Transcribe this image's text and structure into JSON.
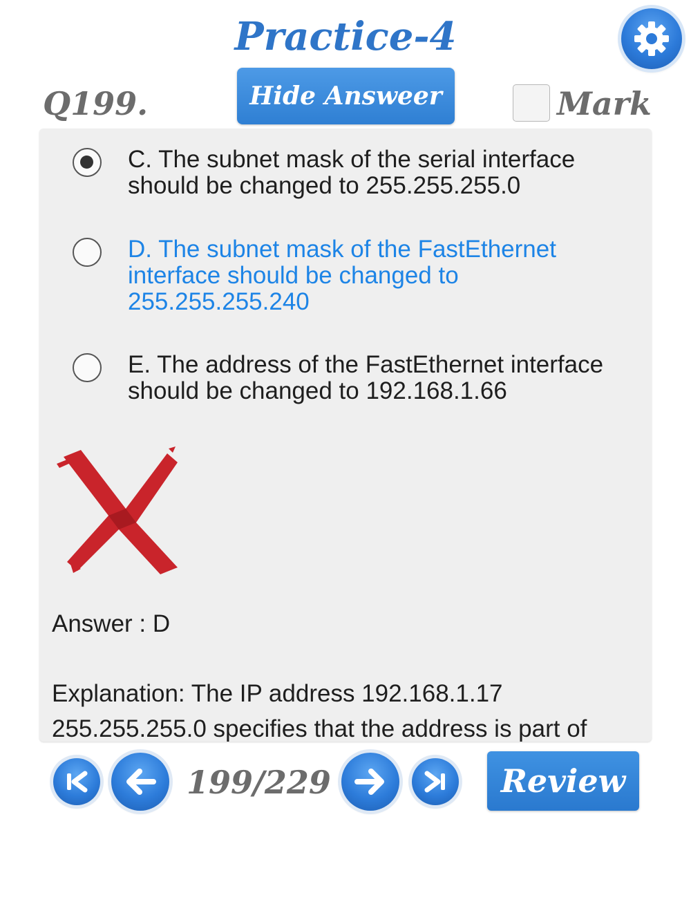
{
  "header": {
    "title": "Practice-4",
    "question_number": "Q199.",
    "hide_answer_label": "Hide Answeer",
    "mark_label": "Mark",
    "mark_checked": false
  },
  "options": [
    {
      "text": "C. The subnet mask of the serial interface should be changed to 255.255.255.0",
      "selected": true,
      "correct": false
    },
    {
      "text": "D. The subnet mask of the FastEthernet interface should be changed to 255.255.255.240",
      "selected": false,
      "correct": true
    },
    {
      "text": "E. The address of the FastEthernet interface should be changed to 192.168.1.66",
      "selected": false,
      "correct": false
    }
  ],
  "result": {
    "status": "incorrect",
    "icon": "red-x-icon"
  },
  "answer_text": "Answer : D",
  "explanation_text": "Explanation: The IP address 192.168.1.17 255.255.255.0 specifies that the address is part of",
  "navigation": {
    "counter": "199/229",
    "review_label": "Review"
  },
  "colors": {
    "accent_blue": "#2f75c8",
    "correct_option": "#1d84e6",
    "wrong_mark": "#c9242b",
    "panel_bg": "#efefef"
  }
}
